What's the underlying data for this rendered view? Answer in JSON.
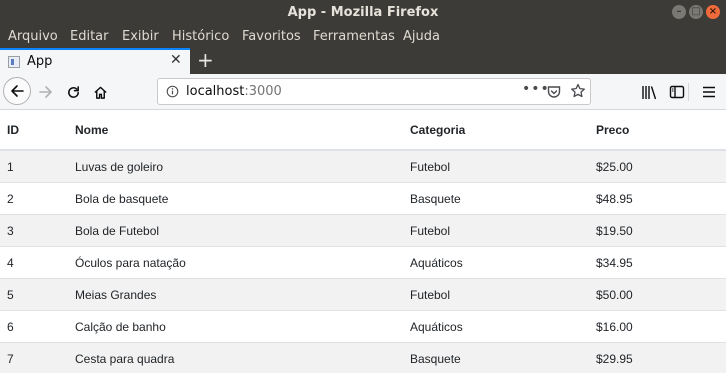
{
  "window": {
    "title": "App - Mozilla Firefox"
  },
  "menu": [
    "Arquivo",
    "Editar",
    "Exibir",
    "Histórico",
    "Favoritos",
    "Ferramentas",
    "Ajuda"
  ],
  "tab": {
    "label": "App"
  },
  "url": {
    "host": "localhost",
    "port": ":3000"
  },
  "table": {
    "headers": [
      "ID",
      "Nome",
      "Categoria",
      "Preco"
    ],
    "rows": [
      [
        "1",
        "Luvas de goleiro",
        "Futebol",
        "$25.00"
      ],
      [
        "2",
        "Bola de basquete",
        "Basquete",
        "$48.95"
      ],
      [
        "3",
        "Bola de Futebol",
        "Futebol",
        "$19.50"
      ],
      [
        "4",
        "Óculos para natação",
        "Aquáticos",
        "$34.95"
      ],
      [
        "5",
        "Meias Grandes",
        "Futebol",
        "$50.00"
      ],
      [
        "6",
        "Calção de banho",
        "Aquáticos",
        "$16.00"
      ],
      [
        "7",
        "Cesta para quadra",
        "Basquete",
        "$29.95"
      ]
    ]
  },
  "colors": {
    "titlebar": "#3c3b37",
    "accent": "#0a84ff",
    "close": "#f06b3b"
  },
  "icons": [
    "back-icon",
    "forward-icon",
    "reload-icon",
    "home-icon",
    "info-icon",
    "more-icon",
    "pocket-icon",
    "bookmark-star-icon",
    "library-icon",
    "sidebar-icon",
    "menu-icon"
  ]
}
